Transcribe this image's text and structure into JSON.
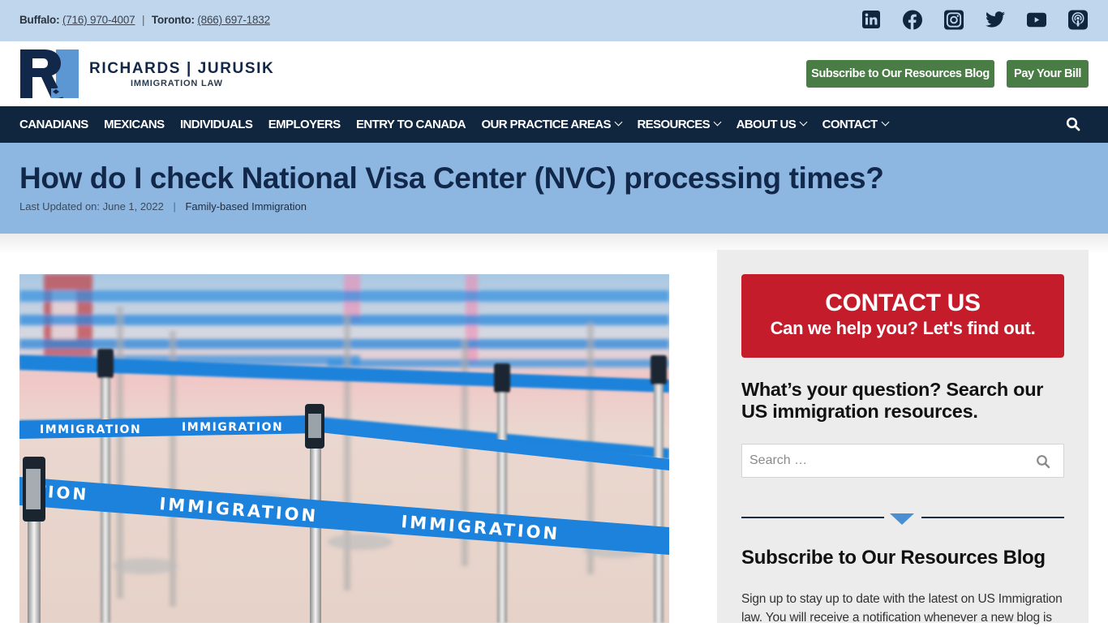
{
  "topbar": {
    "buffalo_label": "Buffalo:",
    "buffalo_phone": "(716) 970-4007",
    "separator": "|",
    "toronto_label": "Toronto:",
    "toronto_phone": "(866) 697-1832",
    "social": [
      {
        "name": "linkedin-icon"
      },
      {
        "name": "facebook-icon"
      },
      {
        "name": "instagram-icon"
      },
      {
        "name": "twitter-icon"
      },
      {
        "name": "youtube-icon"
      },
      {
        "name": "podcast-icon"
      }
    ]
  },
  "header": {
    "logo_initials": "RJ",
    "logo_line1": "RICHARDS | JURUSIK",
    "logo_line2": "IMMIGRATION LAW",
    "subscribe_button": "Subscribe to Our Resources Blog",
    "pay_button": "Pay Your Bill"
  },
  "nav": {
    "items": [
      {
        "label": "CANADIANS",
        "dropdown": false
      },
      {
        "label": "MEXICANS",
        "dropdown": false
      },
      {
        "label": "INDIVIDUALS",
        "dropdown": false
      },
      {
        "label": "EMPLOYERS",
        "dropdown": false
      },
      {
        "label": "ENTRY TO CANADA",
        "dropdown": false
      },
      {
        "label": "OUR PRACTICE AREAS",
        "dropdown": true
      },
      {
        "label": "RESOURCES",
        "dropdown": true
      },
      {
        "label": "ABOUT US",
        "dropdown": true
      },
      {
        "label": "CONTACT",
        "dropdown": true
      }
    ],
    "search_icon": "search-icon"
  },
  "article": {
    "title": "How do I check National Visa Center (NVC) processing times?",
    "last_updated": "Last Updated on: June 1, 2022",
    "meta_separator": "|",
    "category": "Family-based Immigration",
    "image_alt": "Queue barriers with blue IMMIGRATION retractable belts",
    "image_tape_text": "IMMIGRATION"
  },
  "sidebar": {
    "cta_title": "CONTACT US",
    "cta_subtitle": "Can we help you? Let's find out.",
    "search_heading": "What’s your question? Search our US immigration resources.",
    "search_placeholder": "Search …",
    "search_value": "",
    "subscribe_heading": "Subscribe to Our Resources Blog",
    "subscribe_text": "Sign up to stay up to date with the latest on US Immigration law. You will receive a notification whenever a new blog is"
  },
  "colors": {
    "topbar_bg": "#c0d6ec",
    "nav_bg": "#10263f",
    "title_band_bg": "#8db6e0",
    "green_button": "#4a7d45",
    "cta_red": "#c41c2b",
    "divider_accent": "#4a8fd4",
    "brand_navy": "#12284a"
  }
}
